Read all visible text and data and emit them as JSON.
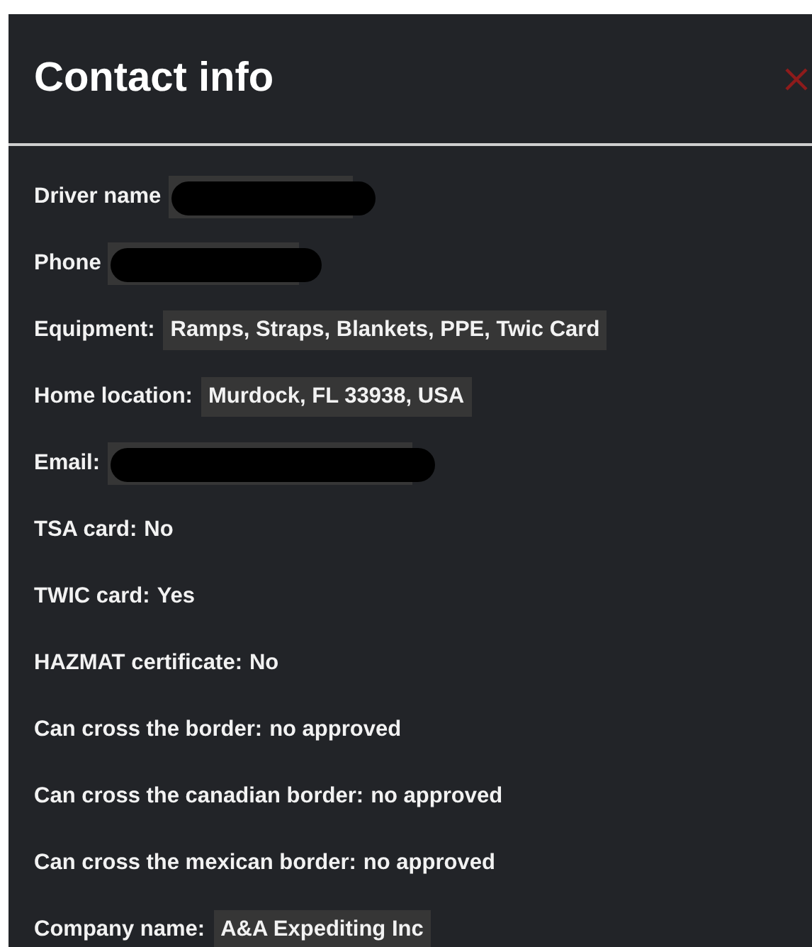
{
  "panel": {
    "title": "Contact info"
  },
  "fields": [
    {
      "label": "Driver name",
      "kind": "redacted"
    },
    {
      "label": "Phone",
      "kind": "redacted"
    },
    {
      "label": "Equipment:",
      "kind": "highlighted",
      "value": "Ramps, Straps, Blankets, PPE, Twic Card"
    },
    {
      "label": "Home location:",
      "kind": "highlighted",
      "value": "Murdock, FL 33938, USA"
    },
    {
      "label": "Email:",
      "kind": "redacted"
    },
    {
      "label": "TSA card:",
      "kind": "plain",
      "value": "No"
    },
    {
      "label": "TWIC card:",
      "kind": "plain",
      "value": "Yes"
    },
    {
      "label": "HAZMAT certificate:",
      "kind": "plain",
      "value": "No"
    },
    {
      "label": "Can cross the border:",
      "kind": "plain",
      "value": "no approved"
    },
    {
      "label": "Can cross the canadian border:",
      "kind": "plain",
      "value": "no approved"
    },
    {
      "label": "Can cross the mexican border:",
      "kind": "plain",
      "value": "no approved"
    },
    {
      "label": "Company name:",
      "kind": "highlighted",
      "value": "A&A Expediting Inc"
    }
  ]
}
